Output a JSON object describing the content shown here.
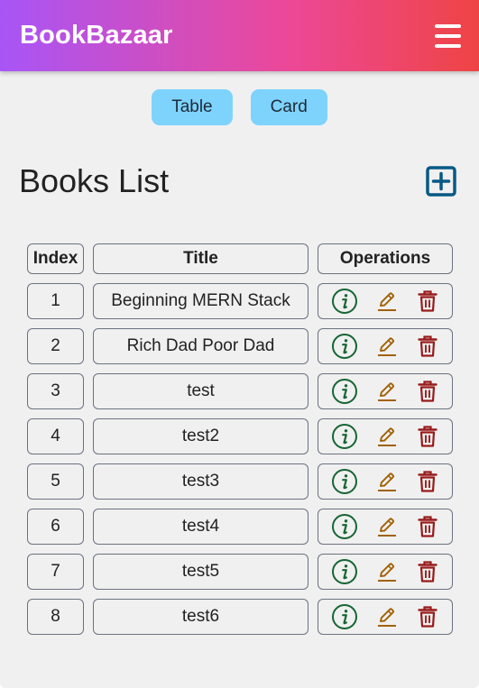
{
  "navbar": {
    "brand": "BookBazaar",
    "menu_icon": "hamburger-menu-icon"
  },
  "view_toggle": {
    "table_label": "Table",
    "card_label": "Card"
  },
  "page": {
    "title": "Books List",
    "add_icon": "plus-square-icon"
  },
  "table": {
    "headers": {
      "index": "Index",
      "title": "Title",
      "operations": "Operations"
    },
    "rows": [
      {
        "index": "1",
        "title": "Beginning MERN Stack"
      },
      {
        "index": "2",
        "title": "Rich Dad Poor Dad"
      },
      {
        "index": "3",
        "title": "test"
      },
      {
        "index": "4",
        "title": "test2"
      },
      {
        "index": "5",
        "title": "test3"
      },
      {
        "index": "6",
        "title": "test4"
      },
      {
        "index": "7",
        "title": "test5"
      },
      {
        "index": "8",
        "title": "test6"
      }
    ],
    "operation_icons": [
      "info-circle-icon",
      "edit-pencil-icon",
      "trash-icon"
    ]
  },
  "colors": {
    "navbar_gradient_start": "#a855f7",
    "navbar_gradient_end": "#ef4444",
    "toggle_button": "#7dd3fc",
    "add_icon": "#075985",
    "info_icon": "#166534",
    "edit_icon": "#a16207",
    "delete_icon": "#991b1b"
  }
}
